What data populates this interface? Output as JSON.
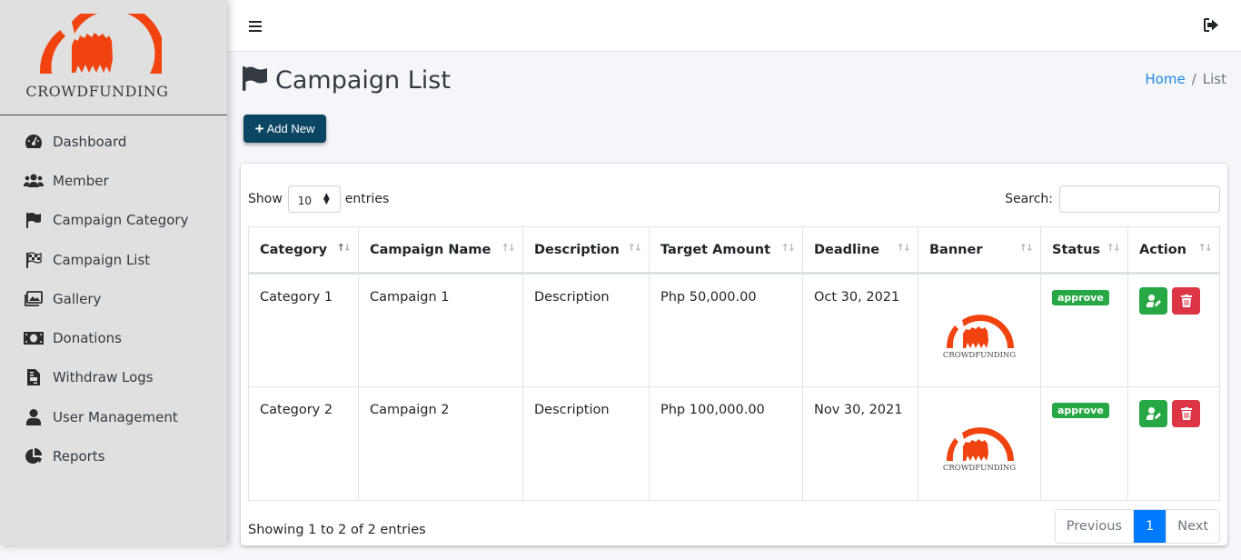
{
  "brand": {
    "name": "CROWDFUNDING",
    "logo_color": "#f0430f"
  },
  "sidebar": {
    "items": [
      {
        "label": "Dashboard",
        "icon": "tachometer-icon"
      },
      {
        "label": "Member",
        "icon": "users-icon"
      },
      {
        "label": "Campaign Category",
        "icon": "flag-icon"
      },
      {
        "label": "Campaign List",
        "icon": "flag-checkered-icon"
      },
      {
        "label": "Gallery",
        "icon": "images-icon"
      },
      {
        "label": "Donations",
        "icon": "money-bill-icon"
      },
      {
        "label": "Withdraw Logs",
        "icon": "file-invoice-icon"
      },
      {
        "label": "User Management",
        "icon": "user-icon"
      },
      {
        "label": "Reports",
        "icon": "chart-pie-icon"
      }
    ]
  },
  "topbar": {
    "menu_icon": "bars-icon",
    "logout_icon": "sign-out-icon"
  },
  "header": {
    "title": "Campaign List",
    "title_icon": "flag-icon",
    "breadcrumb": {
      "home": "Home",
      "separator": "/",
      "current": "List"
    },
    "add_button": "Add New"
  },
  "table_controls": {
    "show_label": "Show",
    "page_size": "10",
    "entries_label": "entries",
    "search_label": "Search:",
    "search_value": ""
  },
  "table": {
    "columns": [
      "Category",
      "Campaign Name",
      "Description",
      "Target Amount",
      "Deadline",
      "Banner",
      "Status",
      "Action"
    ],
    "sorted_column": "Category",
    "rows": [
      {
        "category": "Category 1",
        "name": "Campaign 1",
        "description": "Description",
        "target": "Php 50,000.00",
        "deadline": "Oct 30, 2021",
        "banner_text": "CROWDFUNDING",
        "status": "approve"
      },
      {
        "category": "Category 2",
        "name": "Campaign 2",
        "description": "Description",
        "target": "Php 100,000.00",
        "deadline": "Nov 30, 2021",
        "banner_text": "CROWDFUNDING",
        "status": "approve"
      }
    ]
  },
  "footer": {
    "info": "Showing 1 to 2 of 2 entries",
    "pagination": {
      "previous": "Previous",
      "current": "1",
      "next": "Next"
    }
  },
  "colors": {
    "primary_dark": "#0b4564",
    "success": "#28a745",
    "danger": "#dc3545",
    "page_active": "#007bff",
    "link": "#1e88e5"
  }
}
